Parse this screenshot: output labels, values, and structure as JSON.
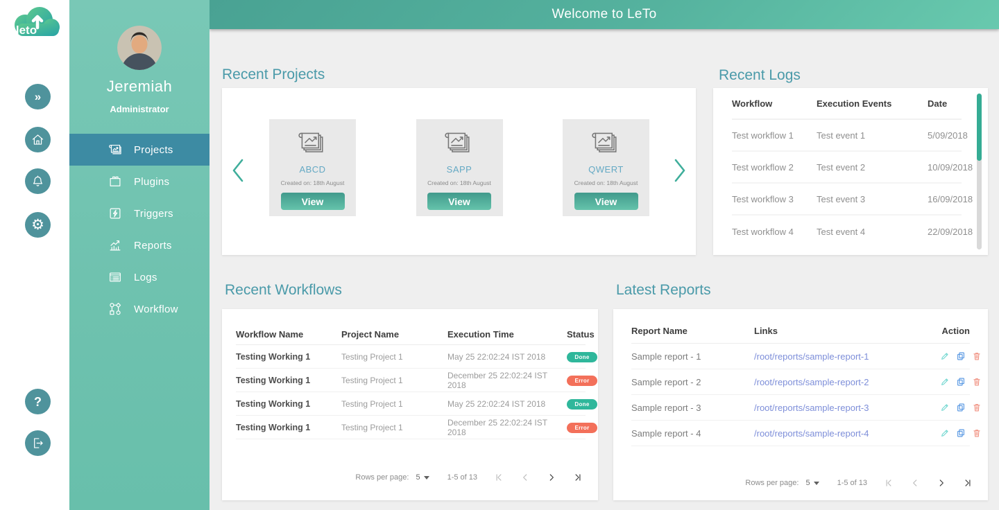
{
  "app": {
    "logo_text": "leto",
    "header_title": "Welcome to LeTo"
  },
  "rail": {
    "icons": [
      "expand-icon",
      "home-icon",
      "notifications-icon",
      "settings-icon",
      "help-icon",
      "logout-icon"
    ],
    "expand_glyph": "»",
    "help_glyph": "?",
    "settings_glyph": "⚙"
  },
  "sidebar": {
    "user": {
      "name": "Jeremiah",
      "role": "Administrator"
    },
    "menu": [
      {
        "label": "Projects",
        "icon": "projects-icon",
        "active": true
      },
      {
        "label": "Plugins",
        "icon": "plugins-icon",
        "active": false
      },
      {
        "label": "Triggers",
        "icon": "triggers-icon",
        "active": false
      },
      {
        "label": "Reports",
        "icon": "reports-icon",
        "active": false
      },
      {
        "label": "Logs",
        "icon": "logs-icon",
        "active": false
      },
      {
        "label": "Workflow",
        "icon": "workflow-icon",
        "active": false
      }
    ]
  },
  "recent_projects": {
    "title": "Recent Projects",
    "view_label": "View",
    "cards": [
      {
        "name": "ABCD",
        "created": "Created on: 18th August"
      },
      {
        "name": "SAPP",
        "created": "Created on: 18th August"
      },
      {
        "name": "QWERT",
        "created": "Created on: 18th August"
      }
    ]
  },
  "recent_logs": {
    "title": "Recent Logs",
    "columns": {
      "c0": "Workflow",
      "c1": "Execution Events",
      "c2": "Date"
    },
    "rows": [
      {
        "workflow": "Test workflow 1",
        "event": "Test event 1",
        "date": "5/09/2018"
      },
      {
        "workflow": "Test workflow 2",
        "event": "Test event 2",
        "date": "10/09/2018"
      },
      {
        "workflow": "Test workflow 3",
        "event": "Test event 3",
        "date": "16/09/2018"
      },
      {
        "workflow": "Test workflow 4",
        "event": "Test event 4",
        "date": "22/09/2018"
      }
    ]
  },
  "recent_workflows": {
    "title": "Recent Workflows",
    "columns": {
      "c0": "Workflow Name",
      "c1": "Project Name",
      "c2": "Execution Time",
      "c3": "Status"
    },
    "rows": [
      {
        "workflow": "Testing Working 1",
        "project": "Testing Project 1",
        "time": "May 25 22:02:24 IST 2018",
        "status": "Done"
      },
      {
        "workflow": "Testing Working 1",
        "project": "Testing Project 1",
        "time": "December 25 22:02:24 IST 2018",
        "status": "Error"
      },
      {
        "workflow": "Testing Working 1",
        "project": "Testing Project 1",
        "time": "May 25 22:02:24 IST 2018",
        "status": "Done"
      },
      {
        "workflow": "Testing Working 1",
        "project": "Testing Project 1",
        "time": "December 25 22:02:24 IST 2018",
        "status": "Error"
      }
    ],
    "pagination": {
      "rows_label": "Rows per page:",
      "per_page": "5",
      "range": "1-5 of 13"
    }
  },
  "latest_reports": {
    "title": "Latest Reports",
    "columns": {
      "c0": "Report Name",
      "c1": "Links",
      "c2": "Action"
    },
    "rows": [
      {
        "name": "Sample report - 1",
        "link": "/root/reports/sample-report-1"
      },
      {
        "name": "Sample report - 2",
        "link": "/root/reports/sample-report-2"
      },
      {
        "name": "Sample report - 3",
        "link": "/root/reports/sample-report-3"
      },
      {
        "name": "Sample report - 4",
        "link": "/root/reports/sample-report-4"
      }
    ],
    "action_icons": [
      "edit-icon",
      "copy-icon",
      "delete-icon"
    ],
    "pagination": {
      "rows_label": "Rows per page:",
      "per_page": "5",
      "range": "1-5 of 13"
    }
  },
  "colors": {
    "sidebar": "#6fc2af",
    "active_menu": "#3d8ba3",
    "rail_button": "#4f939c",
    "accent_title": "#4a9aa9",
    "status_done": "#2fb79b",
    "status_error": "#f3705a",
    "link": "#7d8ed9",
    "header_gradient_start": "#49a293",
    "header_gradient_end": "#68c9ae"
  }
}
